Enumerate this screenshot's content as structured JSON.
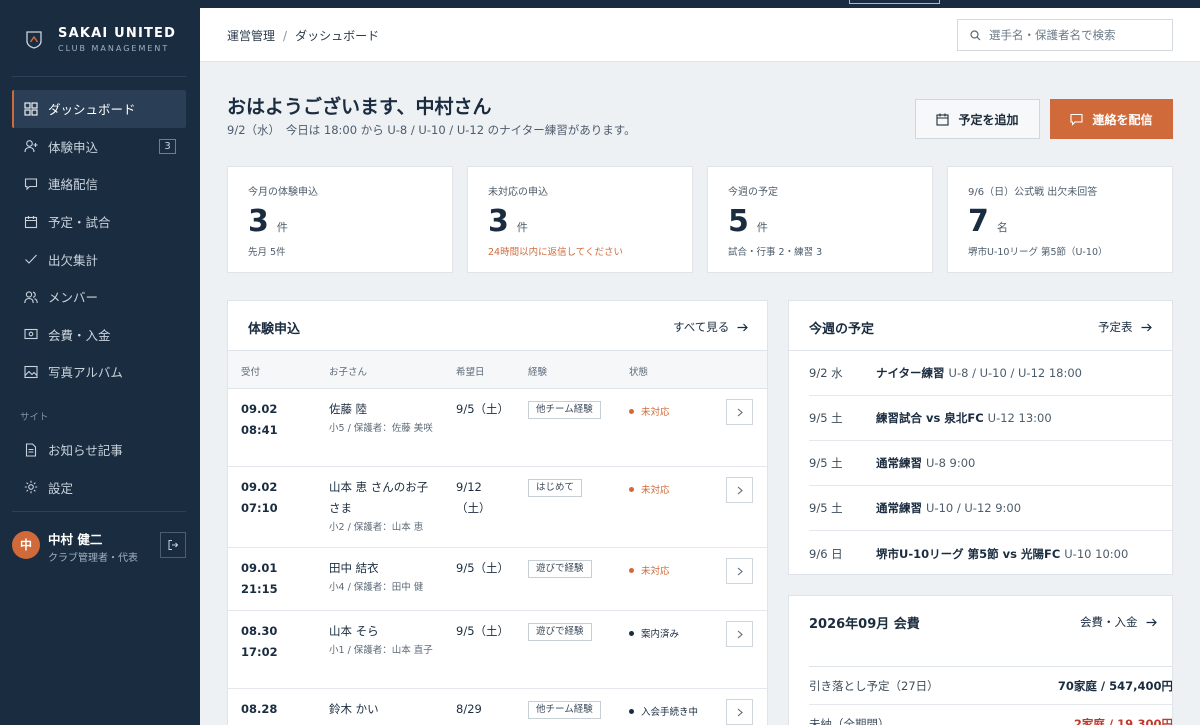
{
  "brand": {
    "title": "SAKAI UNITED",
    "subtitle": "CLUB MANAGEMENT"
  },
  "sidebar": {
    "items": [
      {
        "label": "ダッシュボード",
        "icon": "dashboard-icon",
        "active": true
      },
      {
        "label": "体験申込",
        "icon": "user-add-icon",
        "badge": "3"
      },
      {
        "label": "連絡配信",
        "icon": "message-icon"
      },
      {
        "label": "予定・試合",
        "icon": "calendar-icon"
      },
      {
        "label": "出欠集計",
        "icon": "check-icon"
      },
      {
        "label": "メンバー",
        "icon": "users-icon"
      },
      {
        "label": "会費・入金",
        "icon": "wallet-icon"
      },
      {
        "label": "写真アルバム",
        "icon": "image-icon"
      }
    ],
    "section_label": "サイト",
    "site_items": [
      {
        "label": "お知らせ記事",
        "icon": "document-icon"
      },
      {
        "label": "設定",
        "icon": "gear-icon"
      }
    ],
    "user": {
      "initial": "中",
      "name": "中村 健二",
      "role": "クラブ管理者・代表"
    }
  },
  "header": {
    "breadcrumb": [
      "運営管理",
      "ダッシュボード"
    ],
    "breadcrumb_sep": "/",
    "search_placeholder": "選手名・保護者名で検索"
  },
  "greeting": {
    "title": "おはようございます、中村さん",
    "subtitle": "9/2（水）　今日は 18:00 から U-8 / U-10 / U-12 のナイター練習があります。",
    "add_button": "予定を追加",
    "send_button": "連絡を配信"
  },
  "stats": [
    {
      "label": "今月の体験申込",
      "value": "3",
      "unit": "件",
      "note": "先月 5件",
      "warn": false
    },
    {
      "label": "未対応の申込",
      "value": "3",
      "unit": "件",
      "note": "24時間以内に返信してください",
      "warn": true
    },
    {
      "label": "今週の予定",
      "value": "5",
      "unit": "件",
      "note": "試合・行事 2・練習 3",
      "warn": false
    },
    {
      "label": "9/6（日）公式戦 出欠未回答",
      "value": "7",
      "unit": "名",
      "note": "堺市U-10リーグ 第5節（U-10）",
      "warn": false
    }
  ],
  "trials": {
    "title": "体験申込",
    "link": "すべて見る",
    "columns": [
      "受付",
      "お子さん",
      "希望日",
      "経験",
      "状態"
    ],
    "rows": [
      {
        "date1": "09.02",
        "date2": "08:41",
        "name": "佐藤 陸",
        "sub": "小5 / 保護者：佐藤 美咲",
        "day": "9/5（土）",
        "exp": "他チーム経験",
        "status": "未対応",
        "state": "pending"
      },
      {
        "date1": "09.02",
        "date2": "07:10",
        "name": "山本 恵 さんのお子さま",
        "sub": "小2 / 保護者：山本 恵",
        "day": "9/12（土）",
        "exp": "はじめて",
        "status": "未対応",
        "state": "pending"
      },
      {
        "date1": "09.01",
        "date2": "21:15",
        "name": "田中 結衣",
        "sub": "小4 / 保護者：田中 健",
        "day": "9/5（土）",
        "exp": "遊びで経験",
        "status": "未対応",
        "state": "pending"
      },
      {
        "date1": "08.30",
        "date2": "17:02",
        "name": "山本 そら",
        "sub": "小1 / 保護者：山本 直子",
        "day": "9/5（土）",
        "exp": "遊びで経験",
        "status": "案内済み",
        "state": "done"
      },
      {
        "date1": "08.28",
        "date2": "",
        "name": "鈴木 かい",
        "sub": "",
        "day": "8/29",
        "exp": "他チーム経験",
        "status": "入会手続き中",
        "state": "done"
      }
    ]
  },
  "schedule": {
    "title": "今週の予定",
    "link": "予定表",
    "items": [
      {
        "date": "9/2 水",
        "title": "ナイター練習",
        "detail": "U-8 / U-10 / U-12 18:00"
      },
      {
        "date": "9/5 土",
        "title": "練習試合 vs 泉北FC",
        "detail": "U-12 13:00"
      },
      {
        "date": "9/5 土",
        "title": "通常練習",
        "detail": "U-8 9:00"
      },
      {
        "date": "9/5 土",
        "title": "通常練習",
        "detail": "U-10 / U-12 9:00"
      },
      {
        "date": "9/6 日",
        "title": "堺市U-10リーグ 第5節 vs 光陽FC",
        "detail": "U-10 10:00"
      }
    ]
  },
  "fees": {
    "title": "2026年09月 会費",
    "link": "会費・入金",
    "rows": [
      {
        "label": "引き落とし予定（27日）",
        "value": "70家庭 / 547,400円",
        "red": false
      },
      {
        "label": "未納（全期間）",
        "value": "2家庭 / 19,300円",
        "red": true
      }
    ]
  },
  "colors": {
    "sidebar": "#1a2c3f",
    "accent": "#d06a3a",
    "background": "#eef1f4"
  }
}
